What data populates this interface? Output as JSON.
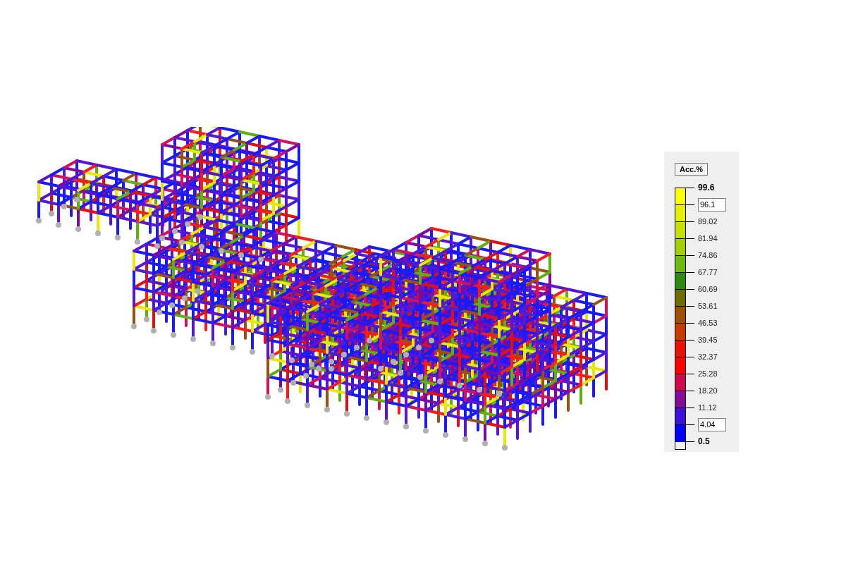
{
  "legend": {
    "title": "Acc.%",
    "bands": [
      {
        "color": "#ffff00"
      },
      {
        "color": "#e6ef00"
      },
      {
        "color": "#c8e000"
      },
      {
        "color": "#a4cf00"
      },
      {
        "color": "#6cbc10"
      },
      {
        "color": "#2c8c10"
      },
      {
        "color": "#6c6c00"
      },
      {
        "color": "#9c5000"
      },
      {
        "color": "#c83c00"
      },
      {
        "color": "#e81400"
      },
      {
        "color": "#ff0000"
      },
      {
        "color": "#d0084c"
      },
      {
        "color": "#880a98"
      },
      {
        "color": "#3c10d8"
      },
      {
        "color": "#0000ff"
      }
    ],
    "ticks": [
      {
        "label": "99.6",
        "kind": "bold"
      },
      {
        "label": "96.1",
        "kind": "input"
      },
      {
        "label": "89.02",
        "kind": "plain"
      },
      {
        "label": "81.94",
        "kind": "plain"
      },
      {
        "label": "74.86",
        "kind": "plain"
      },
      {
        "label": "67.77",
        "kind": "plain"
      },
      {
        "label": "60.69",
        "kind": "plain"
      },
      {
        "label": "53.61",
        "kind": "plain"
      },
      {
        "label": "46.53",
        "kind": "plain"
      },
      {
        "label": "39.45",
        "kind": "plain"
      },
      {
        "label": "32.37",
        "kind": "plain"
      },
      {
        "label": "25.28",
        "kind": "plain"
      },
      {
        "label": "18.20",
        "kind": "plain"
      },
      {
        "label": "11.12",
        "kind": "plain"
      },
      {
        "label": "4.04",
        "kind": "input"
      },
      {
        "label": "0.5",
        "kind": "bold"
      }
    ]
  }
}
